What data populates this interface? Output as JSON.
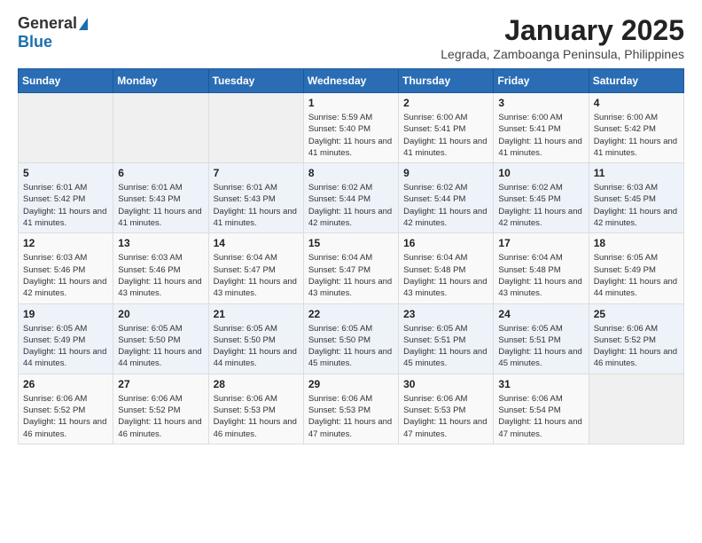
{
  "header": {
    "logo_general": "General",
    "logo_blue": "Blue",
    "month_year": "January 2025",
    "location": "Legrada, Zamboanga Peninsula, Philippines"
  },
  "weekdays": [
    "Sunday",
    "Monday",
    "Tuesday",
    "Wednesday",
    "Thursday",
    "Friday",
    "Saturday"
  ],
  "weeks": [
    [
      {
        "day": "",
        "empty": true
      },
      {
        "day": "",
        "empty": true
      },
      {
        "day": "",
        "empty": true
      },
      {
        "day": "1",
        "sunrise": "Sunrise: 5:59 AM",
        "sunset": "Sunset: 5:40 PM",
        "daylight": "Daylight: 11 hours and 41 minutes."
      },
      {
        "day": "2",
        "sunrise": "Sunrise: 6:00 AM",
        "sunset": "Sunset: 5:41 PM",
        "daylight": "Daylight: 11 hours and 41 minutes."
      },
      {
        "day": "3",
        "sunrise": "Sunrise: 6:00 AM",
        "sunset": "Sunset: 5:41 PM",
        "daylight": "Daylight: 11 hours and 41 minutes."
      },
      {
        "day": "4",
        "sunrise": "Sunrise: 6:00 AM",
        "sunset": "Sunset: 5:42 PM",
        "daylight": "Daylight: 11 hours and 41 minutes."
      }
    ],
    [
      {
        "day": "5",
        "sunrise": "Sunrise: 6:01 AM",
        "sunset": "Sunset: 5:42 PM",
        "daylight": "Daylight: 11 hours and 41 minutes."
      },
      {
        "day": "6",
        "sunrise": "Sunrise: 6:01 AM",
        "sunset": "Sunset: 5:43 PM",
        "daylight": "Daylight: 11 hours and 41 minutes."
      },
      {
        "day": "7",
        "sunrise": "Sunrise: 6:01 AM",
        "sunset": "Sunset: 5:43 PM",
        "daylight": "Daylight: 11 hours and 41 minutes."
      },
      {
        "day": "8",
        "sunrise": "Sunrise: 6:02 AM",
        "sunset": "Sunset: 5:44 PM",
        "daylight": "Daylight: 11 hours and 42 minutes."
      },
      {
        "day": "9",
        "sunrise": "Sunrise: 6:02 AM",
        "sunset": "Sunset: 5:44 PM",
        "daylight": "Daylight: 11 hours and 42 minutes."
      },
      {
        "day": "10",
        "sunrise": "Sunrise: 6:02 AM",
        "sunset": "Sunset: 5:45 PM",
        "daylight": "Daylight: 11 hours and 42 minutes."
      },
      {
        "day": "11",
        "sunrise": "Sunrise: 6:03 AM",
        "sunset": "Sunset: 5:45 PM",
        "daylight": "Daylight: 11 hours and 42 minutes."
      }
    ],
    [
      {
        "day": "12",
        "sunrise": "Sunrise: 6:03 AM",
        "sunset": "Sunset: 5:46 PM",
        "daylight": "Daylight: 11 hours and 42 minutes."
      },
      {
        "day": "13",
        "sunrise": "Sunrise: 6:03 AM",
        "sunset": "Sunset: 5:46 PM",
        "daylight": "Daylight: 11 hours and 43 minutes."
      },
      {
        "day": "14",
        "sunrise": "Sunrise: 6:04 AM",
        "sunset": "Sunset: 5:47 PM",
        "daylight": "Daylight: 11 hours and 43 minutes."
      },
      {
        "day": "15",
        "sunrise": "Sunrise: 6:04 AM",
        "sunset": "Sunset: 5:47 PM",
        "daylight": "Daylight: 11 hours and 43 minutes."
      },
      {
        "day": "16",
        "sunrise": "Sunrise: 6:04 AM",
        "sunset": "Sunset: 5:48 PM",
        "daylight": "Daylight: 11 hours and 43 minutes."
      },
      {
        "day": "17",
        "sunrise": "Sunrise: 6:04 AM",
        "sunset": "Sunset: 5:48 PM",
        "daylight": "Daylight: 11 hours and 43 minutes."
      },
      {
        "day": "18",
        "sunrise": "Sunrise: 6:05 AM",
        "sunset": "Sunset: 5:49 PM",
        "daylight": "Daylight: 11 hours and 44 minutes."
      }
    ],
    [
      {
        "day": "19",
        "sunrise": "Sunrise: 6:05 AM",
        "sunset": "Sunset: 5:49 PM",
        "daylight": "Daylight: 11 hours and 44 minutes."
      },
      {
        "day": "20",
        "sunrise": "Sunrise: 6:05 AM",
        "sunset": "Sunset: 5:50 PM",
        "daylight": "Daylight: 11 hours and 44 minutes."
      },
      {
        "day": "21",
        "sunrise": "Sunrise: 6:05 AM",
        "sunset": "Sunset: 5:50 PM",
        "daylight": "Daylight: 11 hours and 44 minutes."
      },
      {
        "day": "22",
        "sunrise": "Sunrise: 6:05 AM",
        "sunset": "Sunset: 5:50 PM",
        "daylight": "Daylight: 11 hours and 45 minutes."
      },
      {
        "day": "23",
        "sunrise": "Sunrise: 6:05 AM",
        "sunset": "Sunset: 5:51 PM",
        "daylight": "Daylight: 11 hours and 45 minutes."
      },
      {
        "day": "24",
        "sunrise": "Sunrise: 6:05 AM",
        "sunset": "Sunset: 5:51 PM",
        "daylight": "Daylight: 11 hours and 45 minutes."
      },
      {
        "day": "25",
        "sunrise": "Sunrise: 6:06 AM",
        "sunset": "Sunset: 5:52 PM",
        "daylight": "Daylight: 11 hours and 46 minutes."
      }
    ],
    [
      {
        "day": "26",
        "sunrise": "Sunrise: 6:06 AM",
        "sunset": "Sunset: 5:52 PM",
        "daylight": "Daylight: 11 hours and 46 minutes."
      },
      {
        "day": "27",
        "sunrise": "Sunrise: 6:06 AM",
        "sunset": "Sunset: 5:52 PM",
        "daylight": "Daylight: 11 hours and 46 minutes."
      },
      {
        "day": "28",
        "sunrise": "Sunrise: 6:06 AM",
        "sunset": "Sunset: 5:53 PM",
        "daylight": "Daylight: 11 hours and 46 minutes."
      },
      {
        "day": "29",
        "sunrise": "Sunrise: 6:06 AM",
        "sunset": "Sunset: 5:53 PM",
        "daylight": "Daylight: 11 hours and 47 minutes."
      },
      {
        "day": "30",
        "sunrise": "Sunrise: 6:06 AM",
        "sunset": "Sunset: 5:53 PM",
        "daylight": "Daylight: 11 hours and 47 minutes."
      },
      {
        "day": "31",
        "sunrise": "Sunrise: 6:06 AM",
        "sunset": "Sunset: 5:54 PM",
        "daylight": "Daylight: 11 hours and 47 minutes."
      },
      {
        "day": "",
        "empty": true
      }
    ]
  ]
}
